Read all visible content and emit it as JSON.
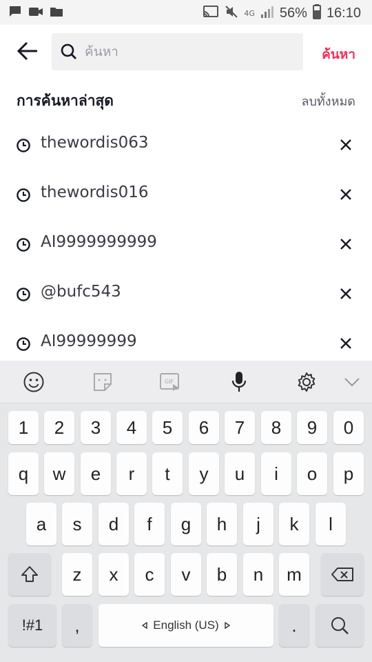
{
  "status_bar": {
    "left_icons": [
      "message-icon",
      "video-icon",
      "folder-icon"
    ],
    "right_icons": [
      "cast-icon",
      "mute-icon",
      "network-icon",
      "signal-icon"
    ],
    "network_label": "4G",
    "battery_percent": "56%",
    "time": "16:10"
  },
  "header": {
    "search_placeholder": "ค้นหา",
    "search_button": "ค้นหา"
  },
  "recent": {
    "title": "การค้นหาล่าสุด",
    "clear_all": "ลบทั้งหมด",
    "items": [
      {
        "text": "thewordis063"
      },
      {
        "text": "thewordis016"
      },
      {
        "text": "AI9999999999"
      },
      {
        "text": "@bufc543"
      },
      {
        "text": "AI99999999"
      }
    ]
  },
  "keyboard": {
    "toolbar": [
      "emoji-icon",
      "sticker-icon",
      "gif-icon",
      "microphone-icon",
      "settings-icon",
      "collapse-icon"
    ],
    "number_row": [
      "1",
      "2",
      "3",
      "4",
      "5",
      "6",
      "7",
      "8",
      "9",
      "0"
    ],
    "row1": [
      "q",
      "w",
      "e",
      "r",
      "t",
      "y",
      "u",
      "i",
      "o",
      "p"
    ],
    "row2": [
      "a",
      "s",
      "d",
      "f",
      "g",
      "h",
      "j",
      "k",
      "l"
    ],
    "row3": [
      "z",
      "x",
      "c",
      "v",
      "b",
      "n",
      "m"
    ],
    "symbols_key": "!#1",
    "comma_key": ",",
    "space_label": "English (US)",
    "period_key": ".",
    "colors": {
      "accent": "#fe2c55",
      "keyboard_bg": "#e6e7e9"
    }
  }
}
